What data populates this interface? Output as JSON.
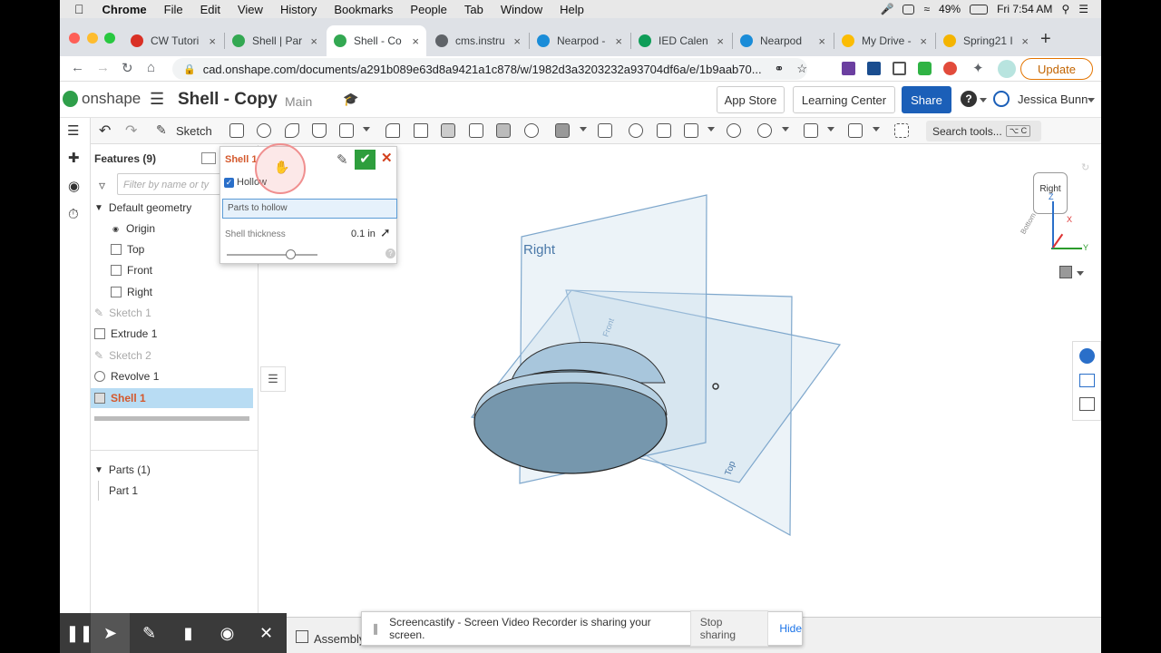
{
  "mac_menu": {
    "app": "Chrome",
    "items": [
      "File",
      "Edit",
      "View",
      "History",
      "Bookmarks",
      "People",
      "Tab",
      "Window",
      "Help"
    ],
    "battery": "49%",
    "clock": "Fri 7:54 AM"
  },
  "tabs": [
    {
      "label": "CW Tutori",
      "color": "#d93025"
    },
    {
      "label": "Shell | Par",
      "color": "#33a852"
    },
    {
      "label": "Shell - Co",
      "color": "#33a852"
    },
    {
      "label": "cms.instru",
      "color": "#5f6368"
    },
    {
      "label": "Nearpod -",
      "color": "#1a8cd8"
    },
    {
      "label": "IED Calen",
      "color": "#0f9d58"
    },
    {
      "label": "Nearpod",
      "color": "#1a8cd8"
    },
    {
      "label": "My Drive -",
      "color": "#fbbc04"
    },
    {
      "label": "Spring21 I",
      "color": "#f4b400"
    }
  ],
  "address": {
    "url": "cad.onshape.com/documents/a291b089e63d8a9421a1c878/w/1982d3a3203232a93704df6a/e/1b9aab70...",
    "update_label": "Update"
  },
  "header": {
    "logo": "onshape",
    "doc_title": "Shell - Copy",
    "branch": "Main",
    "app_store": "App Store",
    "learning_center": "Learning Center",
    "share": "Share",
    "help": "?",
    "user": "Jessica Bunn"
  },
  "toolbar": {
    "sketch": "Sketch",
    "search": "Search tools...",
    "search_shortcut": "⌥ C"
  },
  "features": {
    "title": "Features (9)",
    "filter_placeholder": "Filter by name or ty",
    "default_geometry": "Default geometry",
    "items": [
      "Origin",
      "Top",
      "Front",
      "Right",
      "Sketch 1",
      "Extrude 1",
      "Sketch 2",
      "Revolve 1",
      "Shell 1"
    ],
    "parts_title": "Parts (1)",
    "parts": [
      "Part 1"
    ]
  },
  "dialog": {
    "title": "Shell 1",
    "hollow": "Hollow",
    "parts_field": "Parts to hollow",
    "thickness_label": "Shell thickness",
    "thickness_value": "0.1 in",
    "slider_level": 0.7
  },
  "viewport": {
    "plane_right": "Right",
    "plane_front": "Front",
    "plane_top": "Top",
    "cube_face": "Right",
    "cube_bottom": "Bottom",
    "axis_x": "X",
    "axis_y": "Y",
    "axis_z": "Z"
  },
  "bottom": {
    "assembly_tab": "Assembly",
    "share_msg": "Screencastify - Screen Video Recorder is sharing your screen.",
    "stop_sharing": "Stop sharing",
    "hide": "Hide"
  },
  "colors": {
    "accent": "#2a6fc9",
    "share_btn": "#1b5fb8",
    "confirm_green": "#2e9e3d",
    "cancel_red": "#d3411e",
    "selected_row": "#b8dcf3",
    "shell_label": "#d4582c"
  }
}
